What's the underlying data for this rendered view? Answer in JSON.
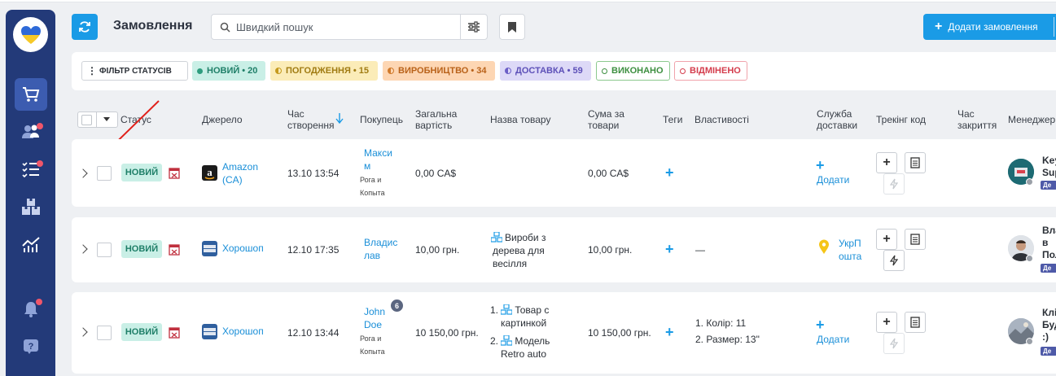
{
  "header": {
    "title": "Замовлення",
    "search_placeholder": "Швидкий пошук",
    "add_order_label": "Додати замовлення"
  },
  "status_filters": {
    "filter_label": "ФІЛЬТР СТАТУСІВ",
    "chips": [
      {
        "label": "НОВИЙ",
        "count": "20"
      },
      {
        "label": "ПОГОДЖЕННЯ",
        "count": "15"
      },
      {
        "label": "ВИРОБНИЦТВО",
        "count": "34"
      },
      {
        "label": "ДОСТАВКА",
        "count": "59"
      },
      {
        "label": "ВИКОНАНО",
        "count": ""
      },
      {
        "label": "ВІДМІНЕНО",
        "count": ""
      }
    ],
    "colors": {
      "new": "#c9efe6",
      "approval": "#fbecb8",
      "production": "#fdd6b3",
      "delivery": "#ddd9f7",
      "done": "#4caf50",
      "canceled": "#e34a5a"
    }
  },
  "columns": {
    "status": "Статус",
    "source": "Джерело",
    "created": "Час створення",
    "buyer": "Покупець",
    "total": "Загальна вартість",
    "product": "Назва товару",
    "sum": "Сума за товари",
    "tags": "Теги",
    "properties": "Властивості",
    "delivery": "Служба доставки",
    "tracking": "Трекінг код",
    "closed": "Час закриття",
    "manager": "Менеджер"
  },
  "orders": [
    {
      "status": "НОВИЙ",
      "source": "Amazon (CA)",
      "created": "13.10 13:54",
      "buyer_line1": "Макси",
      "buyer_line2": "м",
      "buyer_company": "Рога и Копыта",
      "total": "0,00 CA$",
      "sum": "0,00 CA$",
      "delivery": "Додати",
      "manager_line1": "Key",
      "manager_line2": "Sup",
      "manager_tag": "Де"
    },
    {
      "status": "НОВИЙ",
      "source": "Хорошоп",
      "created": "12.10 17:35",
      "buyer_line1": "Владис",
      "buyer_line2": "лав",
      "total": "10,00 грн.",
      "product_line1": "Вироби з",
      "product_line2": "дерева для",
      "product_line3": "весілля",
      "sum": "10,00 грн.",
      "properties": "—",
      "delivery_line1": "УкрП",
      "delivery_line2": "ошта",
      "manager_line1": "Вла",
      "manager_line2": "в",
      "manager_line3": "Пол",
      "manager_tag": "Де"
    },
    {
      "status": "НОВИЙ",
      "source": "Хорошоп",
      "created": "12.10 13:44",
      "buyer_line1": "John",
      "buyer_line2": "Doe",
      "buyer_company": "Рога и Копыта",
      "buyer_badge": "6",
      "total": "10 150,00 грн.",
      "product1_num": "1.",
      "product1_line1": "Товар с",
      "product1_line2": "картинкой",
      "product2_num": "2.",
      "product2_line1": "Модель",
      "product2_line2": "Retro auto",
      "sum": "10 150,00 грн.",
      "prop1": "1. Колір:  11",
      "prop2": "2. Размер:  13\"",
      "delivery": "Додати",
      "manager_line1": "Клі",
      "manager_line2": "Буд",
      "manager_line3": ":)",
      "manager_tag": "Де"
    }
  ]
}
